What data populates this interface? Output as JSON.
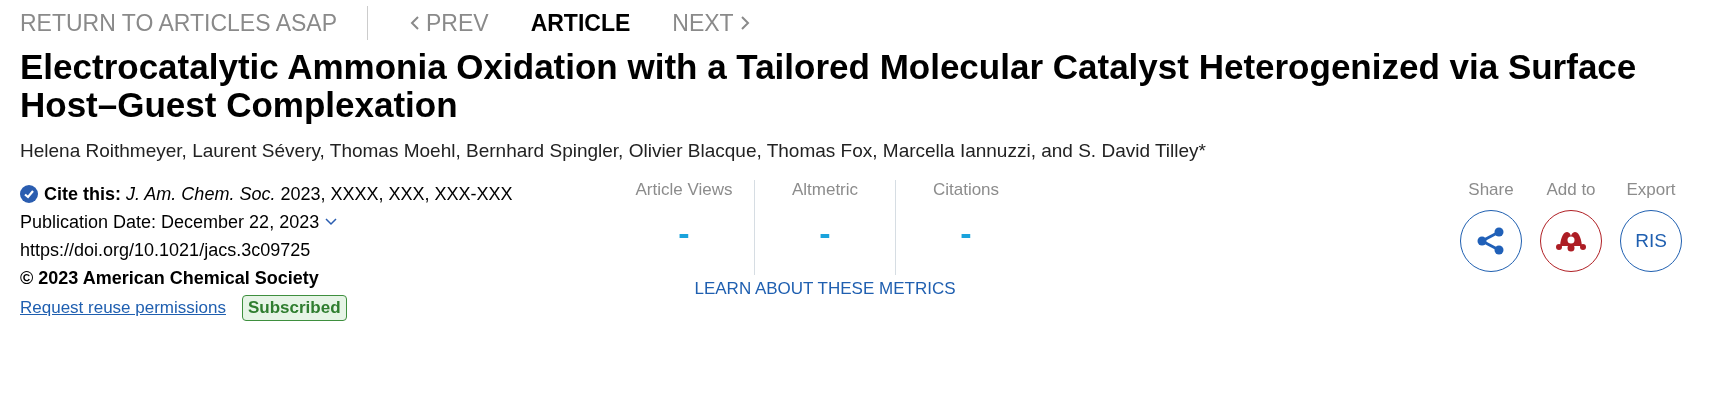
{
  "nav": {
    "back": "RETURN TO ARTICLES ASAP",
    "items": [
      {
        "label": "PREV",
        "kind": "prev",
        "selected": false
      },
      {
        "label": "ARTICLE",
        "kind": "plain",
        "selected": true
      },
      {
        "label": "NEXT",
        "kind": "next",
        "selected": false
      }
    ]
  },
  "title": "Electrocatalytic Ammonia Oxidation with a Tailored Molecular Catalyst Heterogenized via Surface Host–Guest Complexation",
  "authors": "Helena Roithmeyer, Laurent Sévery, Thomas Moehl, Bernhard Spingler, Olivier Blacque, Thomas Fox, Marcella Iannuzzi, and S. David Tilley*",
  "info": {
    "cite": "**Cite this:** *J. Am. Chem. Soc.*  2023, XXXX, XXX, XXX-XXX",
    "publication_date": "Publication Date: December 22, 2023",
    "doi": "https://doi.org/10.1021/jacs.3c09725",
    "copyright": "© 2023 American Chemical Society",
    "reuse_link": "Request reuse permissions",
    "access_badge": "Subscribed"
  },
  "metrics": {
    "items": [
      {
        "label": "Article Views",
        "value": "-"
      },
      {
        "label": "Altmetric",
        "value": "-"
      },
      {
        "label": "Citations",
        "value": "-"
      }
    ],
    "link": "LEARN ABOUT THESE METRICS"
  },
  "actions": [
    {
      "label": "Share",
      "kind": "share"
    },
    {
      "label": "Add to",
      "kind": "mendeley"
    },
    {
      "label": "Export",
      "kind": "text",
      "button_text": "RIS"
    }
  ]
}
